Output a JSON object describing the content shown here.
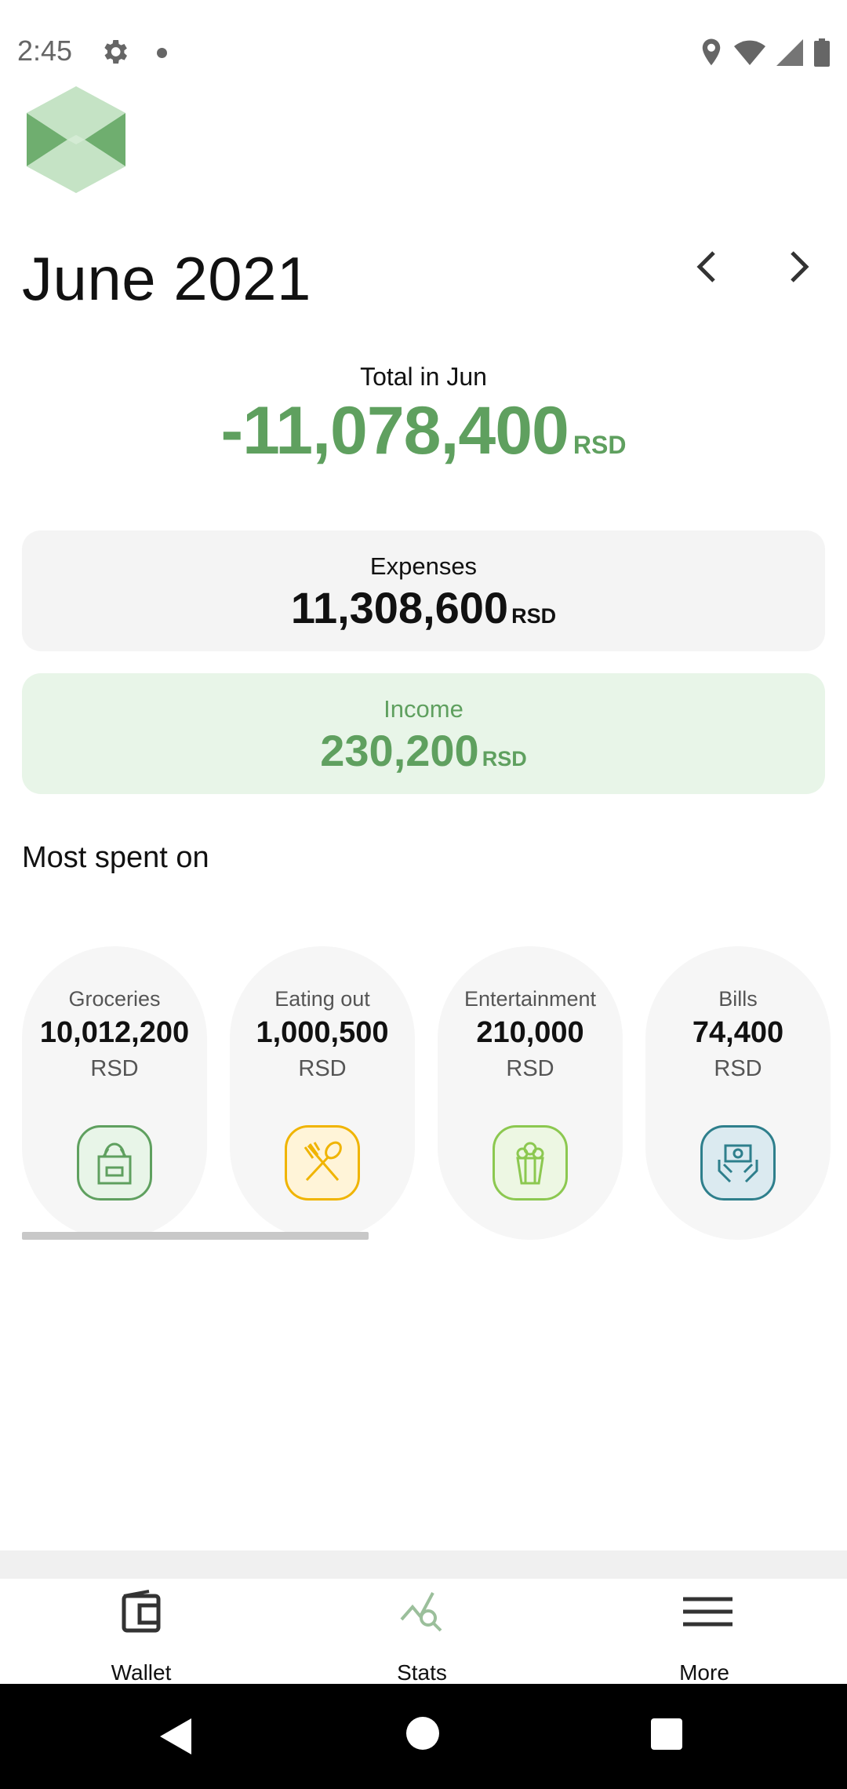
{
  "status_bar": {
    "time": "2:45"
  },
  "header": {
    "month_title": "June 2021"
  },
  "total": {
    "label": "Total in Jun",
    "value": "-11,078,400",
    "currency": "RSD"
  },
  "expenses": {
    "label": "Expenses",
    "value": "11,308,600",
    "currency": "RSD"
  },
  "income": {
    "label": "Income",
    "value": "230,200",
    "currency": "RSD"
  },
  "most_spent": {
    "title": "Most spent on",
    "items": [
      {
        "name": "Groceries",
        "amount": "10,012,200",
        "currency": "RSD",
        "icon": "grocery-bag-icon",
        "color": "#5fa05f",
        "bg": "#e8f5e8"
      },
      {
        "name": "Eating out",
        "amount": "1,000,500",
        "currency": "RSD",
        "icon": "fork-spoon-icon",
        "color": "#f0b400",
        "bg": "#fff4d8"
      },
      {
        "name": "Entertainment",
        "amount": "210,000",
        "currency": "RSD",
        "icon": "popcorn-icon",
        "color": "#8cc850",
        "bg": "#edf7e3"
      },
      {
        "name": "Bills",
        "amount": "74,400",
        "currency": "RSD",
        "icon": "money-hands-icon",
        "color": "#2e7f8c",
        "bg": "#dbeaf0"
      }
    ]
  },
  "bottom_nav": {
    "items": [
      {
        "label": "Wallet",
        "icon": "wallet-icon"
      },
      {
        "label": "Stats",
        "icon": "stats-icon"
      },
      {
        "label": "More",
        "icon": "menu-icon"
      }
    ]
  },
  "colors": {
    "accent": "#5fa05f",
    "card_bg": "#f4f4f4",
    "income_bg": "#e8f5e8"
  }
}
